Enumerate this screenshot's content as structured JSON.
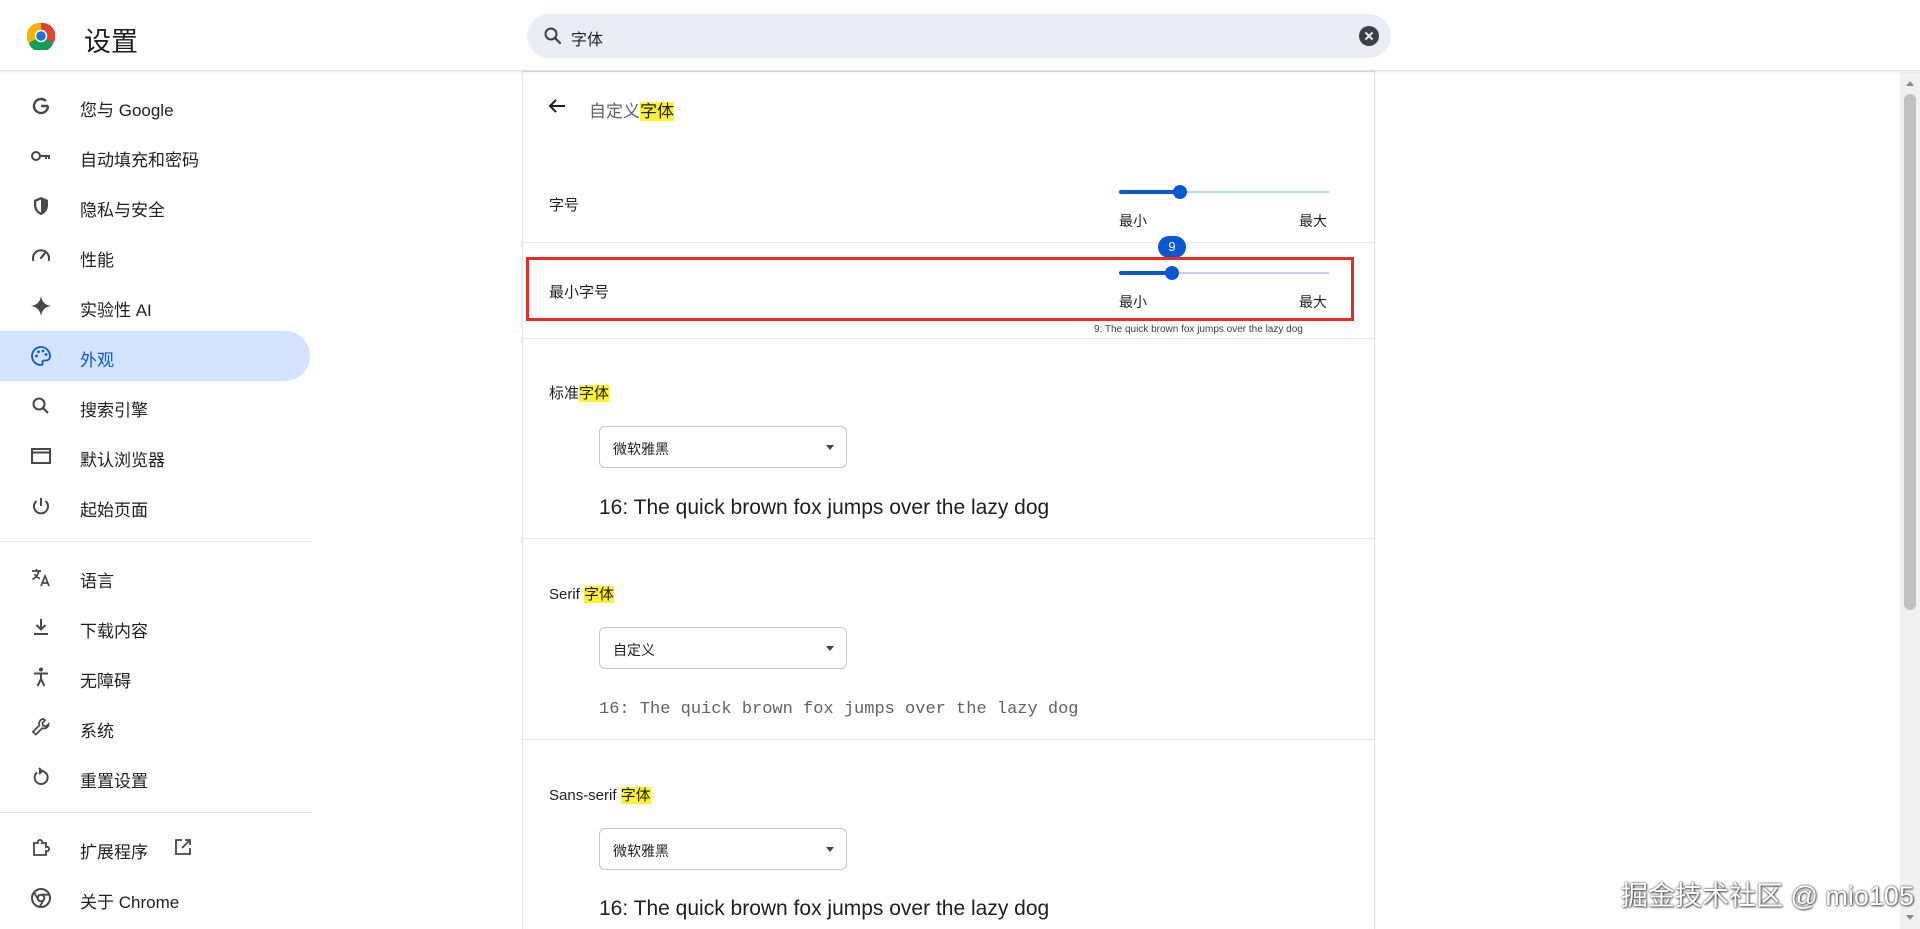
{
  "header": {
    "title": "设置",
    "search_value": "字体"
  },
  "sidebar": {
    "items": [
      {
        "label": "您与 Google",
        "icon": "google-g-icon"
      },
      {
        "label": "自动填充和密码",
        "icon": "key-icon"
      },
      {
        "label": "隐私与安全",
        "icon": "shield-icon"
      },
      {
        "label": "性能",
        "icon": "speedometer-icon"
      },
      {
        "label": "实验性 AI",
        "icon": "sparkle-icon"
      },
      {
        "label": "外观",
        "icon": "palette-icon",
        "active": true
      },
      {
        "label": "搜索引擎",
        "icon": "search-icon"
      },
      {
        "label": "默认浏览器",
        "icon": "browser-window-icon"
      },
      {
        "label": "起始页面",
        "icon": "power-icon"
      },
      {
        "label": "语言",
        "icon": "translate-icon"
      },
      {
        "label": "下载内容",
        "icon": "download-icon"
      },
      {
        "label": "无障碍",
        "icon": "accessibility-icon"
      },
      {
        "label": "系统",
        "icon": "wrench-icon"
      },
      {
        "label": "重置设置",
        "icon": "reset-icon"
      },
      {
        "label": "扩展程序",
        "icon": "puzzle-icon"
      },
      {
        "label": "关于 Chrome",
        "icon": "chrome-icon"
      }
    ]
  },
  "page": {
    "breadcrumb_prefix": "自定义",
    "breadcrumb_highlight": "字体",
    "font_size": {
      "label": "字号",
      "min_label": "最小",
      "max_label": "最大",
      "level": 0.29
    },
    "min_font_size": {
      "label": "最小字号",
      "min_label": "最小",
      "max_label": "最大",
      "level": 0.25,
      "bubble": "9",
      "preview": "9: The quick brown fox jumps over the lazy dog"
    },
    "standard_font": {
      "label": "标准",
      "highlight": "字体",
      "value": "微软雅黑",
      "preview": "16: The quick brown fox jumps over the lazy dog"
    },
    "serif_font": {
      "label": "Serif ",
      "highlight": "字体",
      "value": "自定义",
      "preview": "16: The quick brown fox jumps over the lazy dog"
    },
    "sans_font": {
      "label": "Sans-serif ",
      "highlight": "字体",
      "value": "微软雅黑",
      "preview": "16: The quick brown fox jumps over the lazy dog"
    }
  },
  "watermark": "掘金技术社区 @ mio105",
  "colors": {
    "accent": "#0b57d0",
    "active_bg": "#d3e3fd",
    "highlight": "#fff236",
    "annotation": "#e52b2b"
  }
}
